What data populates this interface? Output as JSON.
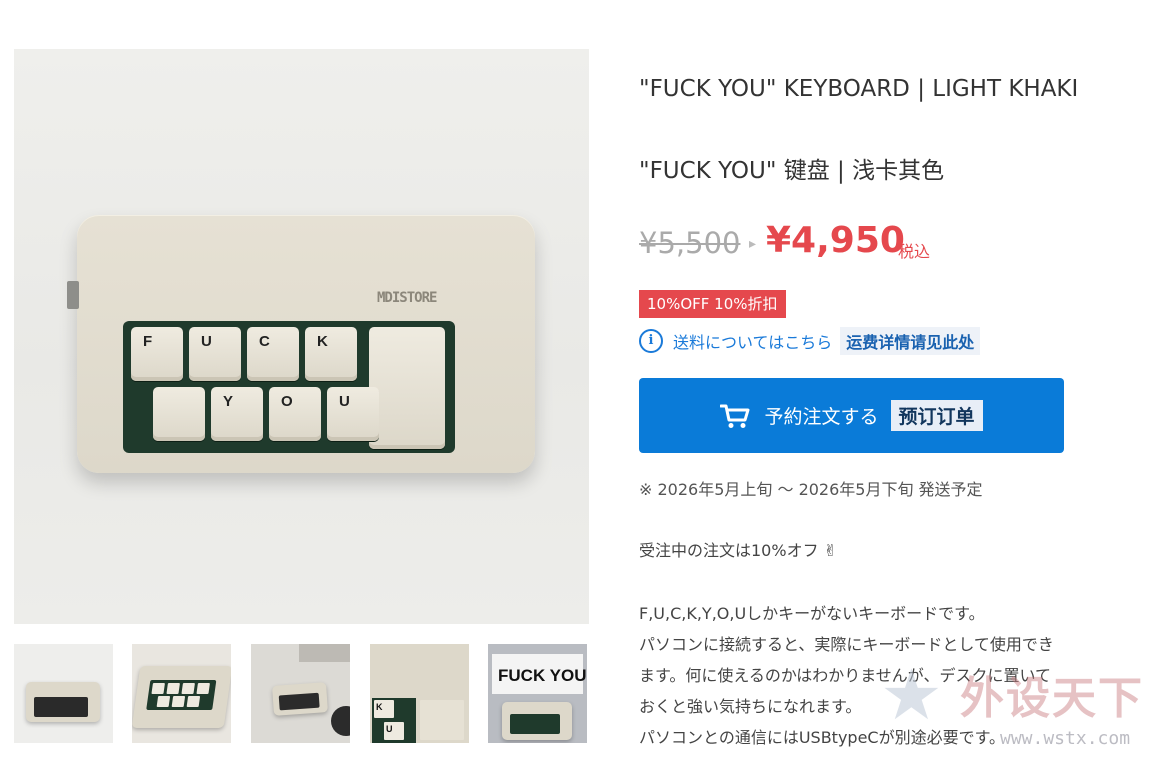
{
  "product": {
    "title_en": "\"FUCK YOU\" KEYBOARD | LIGHT KHAKI",
    "title_cn": "\"FUCK YOU\" 键盘 | 浅卡其色",
    "price_original": "¥5,500",
    "price_sale": "¥4,950",
    "tax_label": "税込",
    "discount_badge": "10%OFF  10%折扣",
    "shipping_link": "送料についてはこちら",
    "shipping_link_cn": "运费详情请见此处",
    "order_button": "予約注文する",
    "order_button_cn": "预订订单",
    "shipping_note": "※ 2026年5月上旬 〜 2026年5月下旬 発送予定",
    "promo_text": "受注中の注文は10%オフ ✌",
    "description": [
      "F,U,C,K,Y,O,Uしかキーがないキーボードです。",
      "パソコンに接続すると、実際にキーボードとして使用でき",
      "ます。何に使えるのかはわかりませんが、デスクに置いて",
      "おくと強い気持ちになれます。",
      "パソコンとの通信にはUSBtypeCが別途必要です。"
    ]
  },
  "gallery": {
    "keyboard_logo": "MDISTORE",
    "keys_row1": [
      "F",
      "U",
      "C",
      "K"
    ],
    "keys_row2": [
      "",
      "Y",
      "O",
      "U"
    ],
    "thumb5_text": "FUCK YOU",
    "thumb4_keys": [
      "K",
      "U"
    ]
  },
  "watermark": {
    "logo": "外设天下",
    "url": "www.wstx.com"
  },
  "colors": {
    "sale_red": "#e5484d",
    "link_blue": "#1a7ad9",
    "button_blue": "#0a7bd8",
    "keyboard_body": "#ddd8ca",
    "pcb_green": "#1f3a2c"
  },
  "icons": [
    "info-icon",
    "cart-icon",
    "star-watermark-icon"
  ]
}
